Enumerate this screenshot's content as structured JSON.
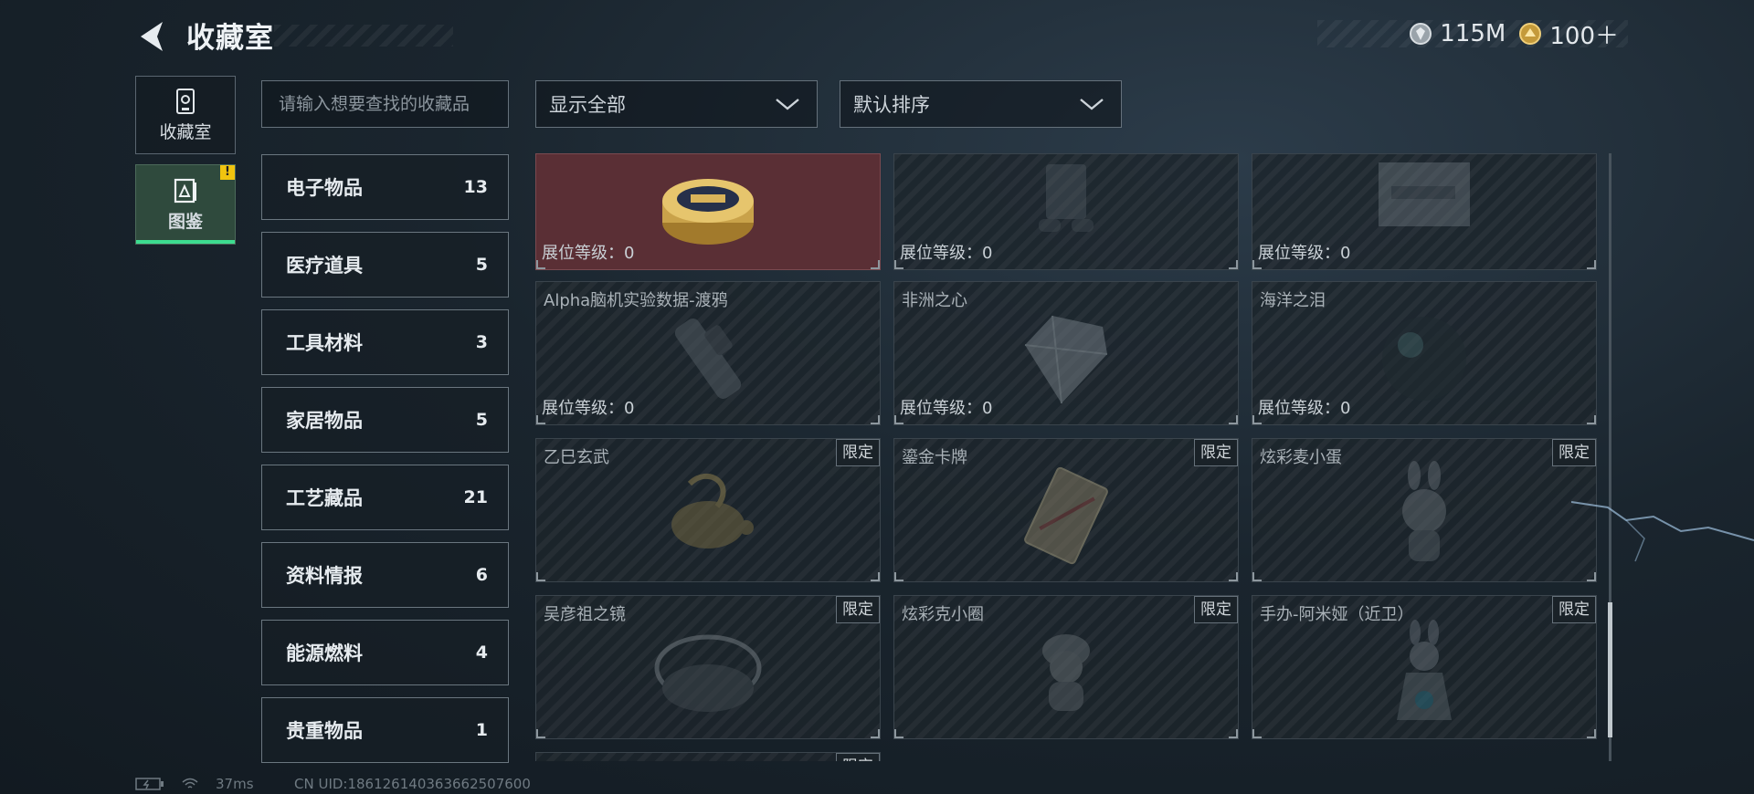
{
  "header": {
    "title": "收藏室",
    "currency": [
      {
        "icon": "silver-coin-icon",
        "value": "115M"
      },
      {
        "icon": "gold-coin-icon",
        "value": "100＋"
      }
    ]
  },
  "nav": {
    "collection_label": "收藏室",
    "codex_label": "图鉴",
    "codex_badge": "!"
  },
  "search": {
    "placeholder": "请输入想要查找的收藏品"
  },
  "filters": {
    "display": "显示全部",
    "sort": "默认排序"
  },
  "categories": [
    {
      "label": "电子物品",
      "count": "13"
    },
    {
      "label": "医疗道具",
      "count": "5"
    },
    {
      "label": "工具材料",
      "count": "3"
    },
    {
      "label": "家居物品",
      "count": "5"
    },
    {
      "label": "工艺藏品",
      "count": "21"
    },
    {
      "label": "资料情报",
      "count": "6"
    },
    {
      "label": "能源燃料",
      "count": "4"
    },
    {
      "label": "贵重物品",
      "count": "1"
    }
  ],
  "level_label": "展位等级：",
  "limited_label": "限定",
  "items": [
    {
      "name": "",
      "level": "0",
      "icon": "caviar-tin-icon",
      "owned": true
    },
    {
      "name": "",
      "level": "0",
      "icon": "device-icon"
    },
    {
      "name": "",
      "level": "0",
      "icon": "card-icon"
    },
    {
      "name": "Alpha脑机实验数据-渡鸦",
      "level": "0",
      "icon": "data-device-icon"
    },
    {
      "name": "非洲之心",
      "level": "0",
      "icon": "diamond-icon"
    },
    {
      "name": "海洋之泪",
      "level": "0",
      "icon": "orb-icon"
    },
    {
      "name": "乙巳玄武",
      "icon": "turtle-figure-icon",
      "limited": true
    },
    {
      "name": "鎏金卡牌",
      "icon": "golden-card-icon",
      "limited": true
    },
    {
      "name": "炫彩麦小蛋",
      "icon": "bunny-figure-icon",
      "limited": true
    },
    {
      "name": "吴彦祖之镜",
      "icon": "mirror-icon",
      "limited": true
    },
    {
      "name": "炫彩克小圈",
      "icon": "figure-icon",
      "limited": true
    },
    {
      "name": "手办-阿米娅（近卫）",
      "icon": "figurine-icon",
      "limited": true
    }
  ],
  "status": {
    "ping": "37ms",
    "uid": "CN UID:18612614036366250760​0"
  }
}
